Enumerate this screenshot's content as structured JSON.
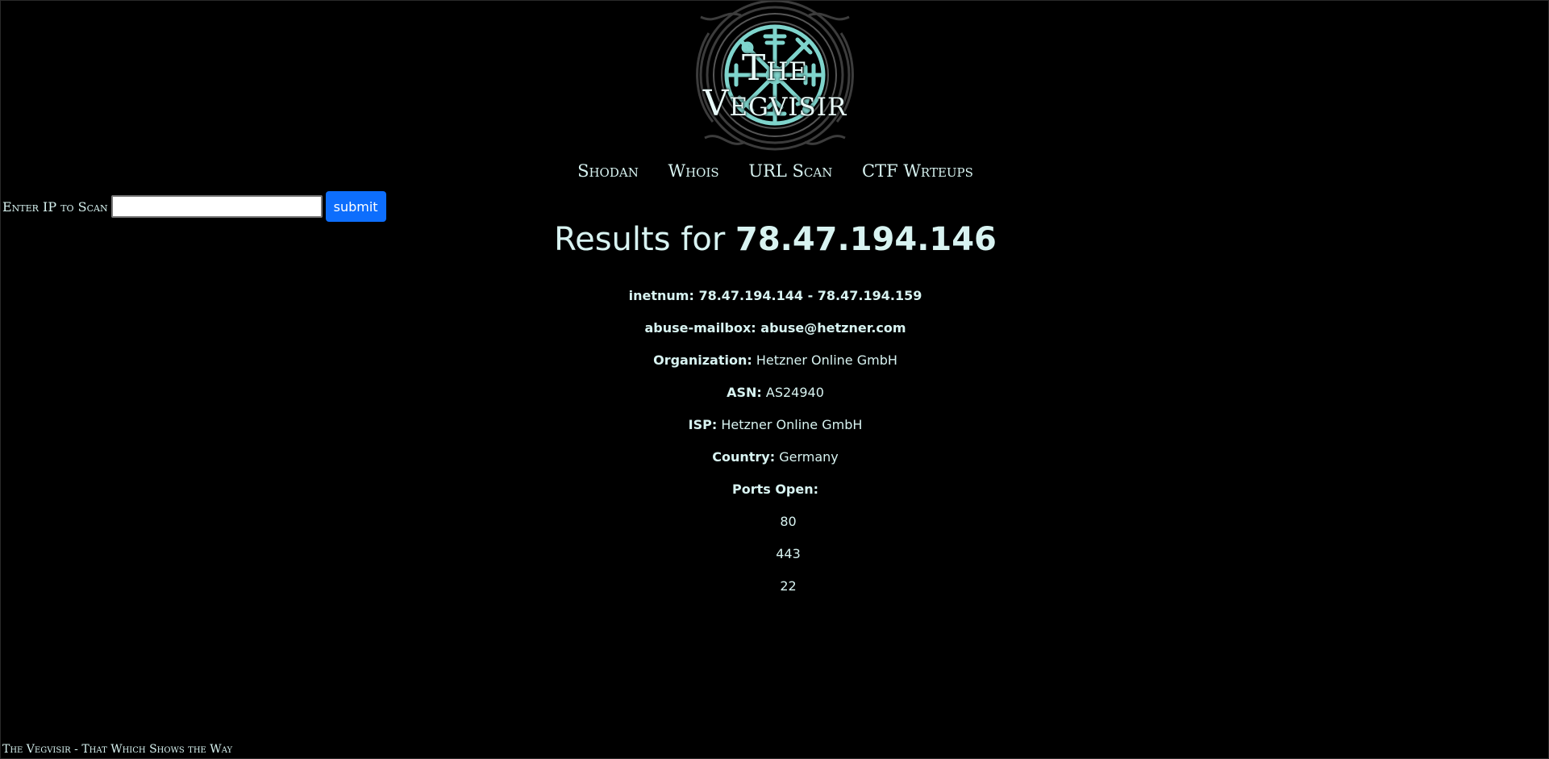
{
  "header": {
    "site_title": "The Vegvisir"
  },
  "nav": {
    "items": [
      "Shodan",
      "Whois",
      "URL Scan",
      "CTF Wrteups"
    ]
  },
  "scan_form": {
    "label": "Enter IP to Scan",
    "input_value": "",
    "submit_label": "submit"
  },
  "results": {
    "title_prefix": "Results for ",
    "ip": "78.47.194.146",
    "inetnum": "inetnum: 78.47.194.144 - 78.47.194.159",
    "abuse_mailbox": "abuse-mailbox: abuse@hetzner.com",
    "organization_label": "Organization:",
    "organization": "Hetzner Online GmbH",
    "asn_label": "ASN:",
    "asn": "AS24940",
    "isp_label": "ISP:",
    "isp": "Hetzner Online GmbH",
    "country_label": "Country:",
    "country": "Germany",
    "ports_label": "Ports Open:",
    "ports": [
      "80",
      "443",
      "22"
    ]
  },
  "footer": {
    "text": "The Vegvisir - That Which Shows the Way"
  },
  "colors": {
    "background": "#000000",
    "text": "#d8f3f1",
    "accent": "#7fd4cc",
    "button": "#0d6efd"
  }
}
